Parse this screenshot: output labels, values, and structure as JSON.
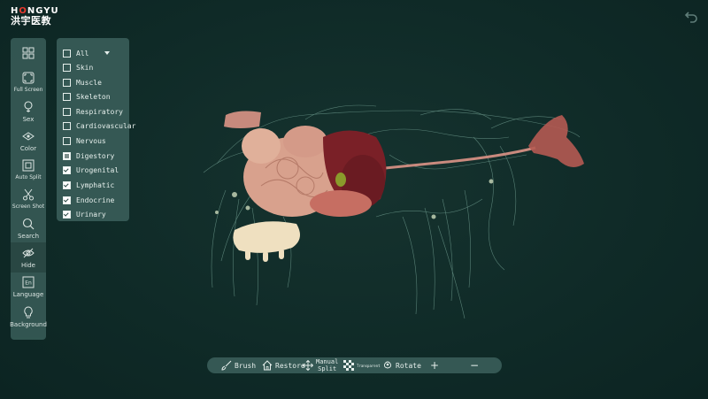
{
  "logo": {
    "top_text_pre": "H",
    "top_text_accent": "O",
    "top_text_post": "NGYU",
    "bottom_text": "洪宇医教"
  },
  "back_button": {
    "icon": "back-arrow-icon"
  },
  "left_toolbar": {
    "items": [
      {
        "id": "layout",
        "label": "",
        "icon": "grid-icon"
      },
      {
        "id": "fullscreen",
        "label": "Full Screen",
        "icon": "fullscreen-icon"
      },
      {
        "id": "sex",
        "label": "Sex",
        "icon": "sex-icon"
      },
      {
        "id": "color",
        "label": "Color",
        "icon": "color-icon"
      },
      {
        "id": "autosplit",
        "label": "Auto Split",
        "icon": "auto-split-icon"
      },
      {
        "id": "screenshot",
        "label": "Screen Shot",
        "icon": "scissors-icon"
      },
      {
        "id": "search",
        "label": "Search",
        "icon": "search-icon"
      },
      {
        "id": "hide",
        "label": "Hide",
        "icon": "eye-icon"
      },
      {
        "id": "language",
        "label": "Language",
        "icon": "language-icon",
        "badge": "En"
      },
      {
        "id": "background",
        "label": "Background",
        "icon": "lightbulb-icon"
      }
    ]
  },
  "layer_panel": {
    "items": [
      {
        "label": "All",
        "state": "unchecked",
        "dropdown": true
      },
      {
        "label": "Skin",
        "state": "unchecked"
      },
      {
        "label": "Muscle",
        "state": "unchecked"
      },
      {
        "label": "Skeleton",
        "state": "unchecked"
      },
      {
        "label": "Respiratory",
        "state": "unchecked"
      },
      {
        "label": "Cardiovascular",
        "state": "unchecked"
      },
      {
        "label": "Nervous",
        "state": "unchecked"
      },
      {
        "label": "Digestory",
        "state": "partial"
      },
      {
        "label": "Urogenital",
        "state": "checked"
      },
      {
        "label": "Lymphatic",
        "state": "checked"
      },
      {
        "label": "Endocrine",
        "state": "checked"
      },
      {
        "label": "Urinary",
        "state": "checked"
      }
    ]
  },
  "bottom_bar": {
    "brush_label": "Brush",
    "restore_label": "Restore",
    "manual_split_line1": "Manual",
    "manual_split_line2": "Split",
    "transparent_label": "Transparent",
    "rotate_label": "Rotate",
    "zoom_in_label": "+",
    "zoom_out_label": "−"
  },
  "colors": {
    "background": "#0f2a27",
    "panel": "#355854",
    "text": "#e6efec",
    "logo_accent": "#e8392e"
  }
}
